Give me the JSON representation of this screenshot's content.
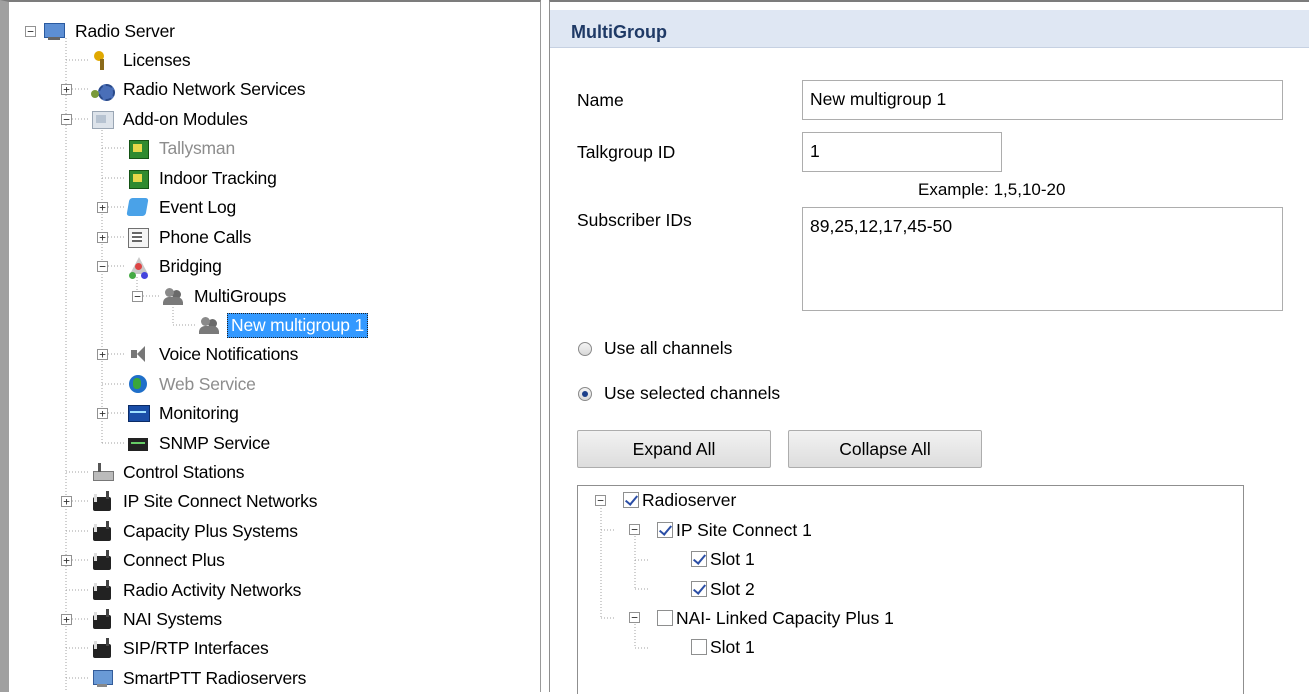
{
  "tree": {
    "nodes": [
      {
        "label": "Radio Server",
        "icon": "server-icon"
      },
      {
        "label": "Licenses",
        "icon": "key-icon"
      },
      {
        "label": "Radio Network Services",
        "icon": "gear-icon"
      },
      {
        "label": "Add-on Modules",
        "icon": "addon-modules-icon"
      },
      {
        "label": "Tallysman",
        "icon": "module-icon"
      },
      {
        "label": "Indoor Tracking",
        "icon": "module-icon"
      },
      {
        "label": "Event Log",
        "icon": "event-log-icon"
      },
      {
        "label": "Phone Calls",
        "icon": "phone-icon"
      },
      {
        "label": "Bridging",
        "icon": "bridging-icon"
      },
      {
        "label": "MultiGroups",
        "icon": "group-icon"
      },
      {
        "label": "New multigroup 1",
        "icon": "group-icon"
      },
      {
        "label": "Voice Notifications",
        "icon": "speaker-icon"
      },
      {
        "label": "Web Service",
        "icon": "globe-icon"
      },
      {
        "label": "Monitoring",
        "icon": "monitor-icon"
      },
      {
        "label": "SNMP Service",
        "icon": "snmp-icon"
      },
      {
        "label": "Control Stations",
        "icon": "control-station-icon"
      },
      {
        "label": "IP Site Connect Networks",
        "icon": "radio-icon"
      },
      {
        "label": "Capacity Plus Systems",
        "icon": "radio-icon"
      },
      {
        "label": "Connect Plus",
        "icon": "radio-icon"
      },
      {
        "label": "Radio Activity Networks",
        "icon": "radio-icon"
      },
      {
        "label": "NAI Systems",
        "icon": "radio-icon"
      },
      {
        "label": "SIP/RTP Interfaces",
        "icon": "radio-icon"
      },
      {
        "label": "SmartPTT Radioservers",
        "icon": "pc-icon"
      }
    ]
  },
  "multigroup": {
    "title": "MultiGroup",
    "name_label": "Name",
    "name_value": "New multigroup 1",
    "talkgroup_label": "Talkgroup ID",
    "talkgroup_value": "1",
    "example_text": "Example: 1,5,10-20",
    "subscriber_label": "Subscriber IDs",
    "subscriber_value": "89,25,12,17,45-50",
    "use_all_label": "Use all channels",
    "use_selected_label": "Use selected channels",
    "expand_all_label": "Expand All",
    "collapse_all_label": "Collapse All"
  },
  "channels": {
    "nodes": [
      {
        "label": "Radioserver",
        "checked": true
      },
      {
        "label": "IP Site Connect 1",
        "checked": true
      },
      {
        "label": "Slot 1",
        "checked": true
      },
      {
        "label": "Slot 2",
        "checked": true
      },
      {
        "label": "NAI- Linked Capacity Plus 1",
        "checked": false
      },
      {
        "label": "Slot 1",
        "checked": false
      }
    ]
  },
  "colors": {
    "selection": "#3399ff",
    "header_bg": "#dfe7f3",
    "disabled_text": "#8d8d8d",
    "check_mark": "#2b4ea6"
  }
}
